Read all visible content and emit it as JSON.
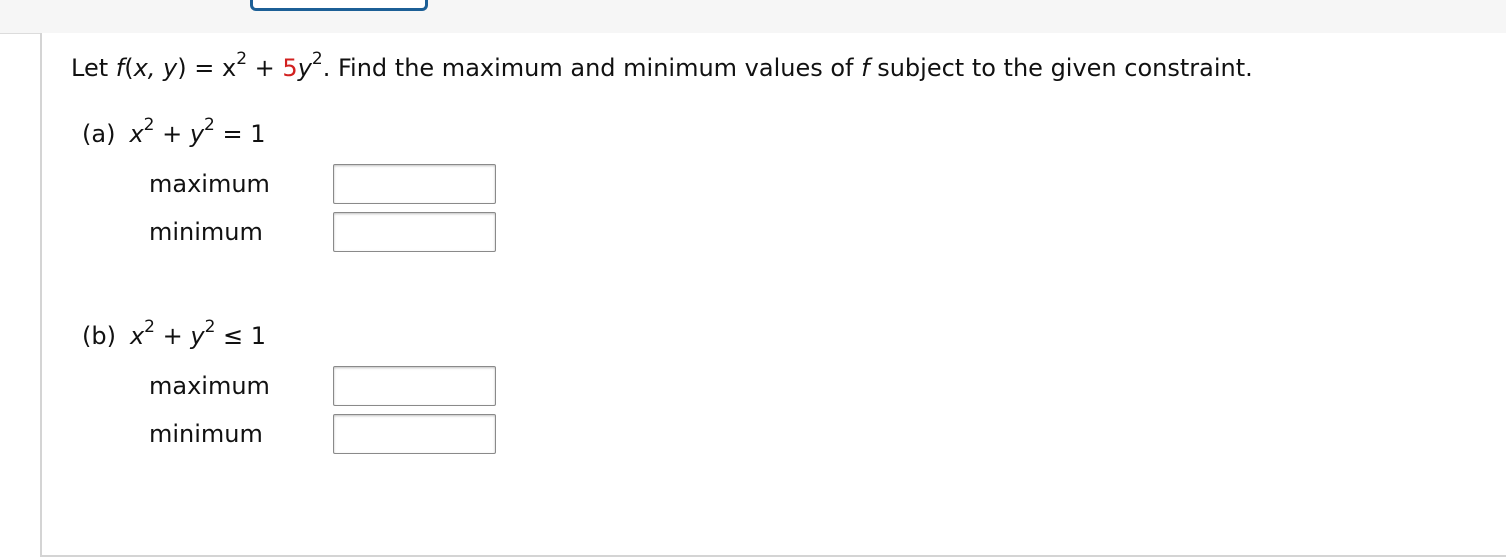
{
  "question": {
    "prefix": "Let ",
    "func_name": "f",
    "func_args_open": "(",
    "func_args": "x, y",
    "func_args_close": ")",
    "equals": " = ",
    "x_base": "x",
    "exp_two": "2",
    "plus": " + ",
    "coef": "5",
    "y_base": "y",
    "rest_prefix": ". Find the maximum and minimum values of ",
    "rest_f": "f",
    "rest_suffix": " subject to the given constraint.",
    "coef_color": "#d2201f"
  },
  "parts": [
    {
      "marker": "(a)",
      "x": "x",
      "exp": "2",
      "plus": " + ",
      "y": "y",
      "relation": " = 1",
      "maximum_label": "maximum",
      "minimum_label": "minimum",
      "maximum_value": "",
      "minimum_value": ""
    },
    {
      "marker": "(b)",
      "x": "x",
      "exp": "2",
      "plus": " + ",
      "y": "y",
      "relation": " ≤ 1",
      "maximum_label": "maximum",
      "minimum_label": "minimum",
      "maximum_value": "",
      "minimum_value": ""
    }
  ]
}
